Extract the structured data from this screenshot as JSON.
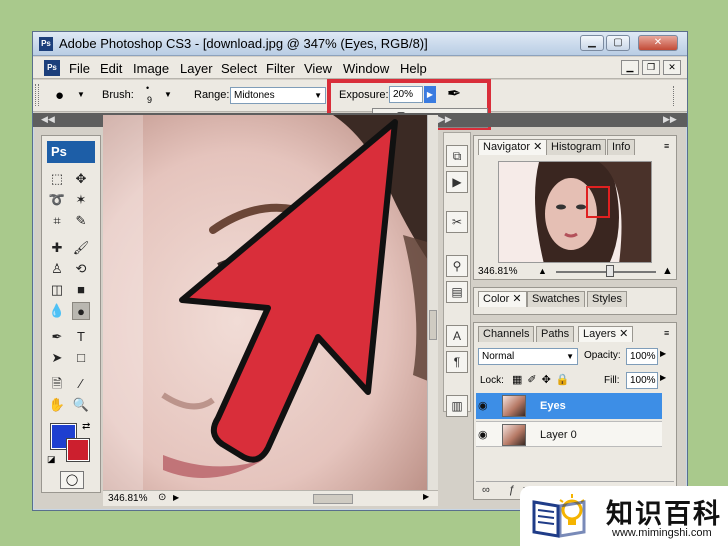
{
  "window": {
    "title": "Adobe Photoshop CS3 - [download.jpg @ 347% (Eyes, RGB/8)]",
    "app_badge": "Ps"
  },
  "menu": {
    "items": [
      "File",
      "Edit",
      "Image",
      "Layer",
      "Select",
      "Filter",
      "View",
      "Window",
      "Help"
    ]
  },
  "options": {
    "brush_label": "Brush:",
    "brush_size": "9",
    "range_label": "Range:",
    "range_value": "Midtones",
    "exposure_label": "Exposure:",
    "exposure_value": "20%",
    "exposure_fraction": 0.2
  },
  "toolbox": {
    "badge": "Ps"
  },
  "navigator": {
    "tabs": [
      "Navigator",
      "Histogram",
      "Info"
    ],
    "zoom": "346.81%"
  },
  "color_panel": {
    "tabs": [
      "Color",
      "Swatches",
      "Styles"
    ]
  },
  "layers_panel": {
    "tabs": [
      "Channels",
      "Paths",
      "Layers"
    ],
    "blend_mode": "Normal",
    "opacity_label": "Opacity:",
    "opacity_value": "100%",
    "lock_label": "Lock:",
    "fill_label": "Fill:",
    "fill_value": "100%",
    "layers": [
      {
        "name": "Eyes",
        "selected": true
      },
      {
        "name": "Layer 0",
        "selected": false
      }
    ]
  },
  "status": {
    "zoom": "346.81%"
  },
  "watermark": {
    "chinese": "知识百科",
    "url": "www.mimingshi.com"
  },
  "colors": {
    "foreground": "#1e3fd0",
    "background": "#cc1f2e",
    "arrow": "#d92e3a",
    "highlight_box": "#d92e3a",
    "selected_layer": "#3d8ee6"
  }
}
